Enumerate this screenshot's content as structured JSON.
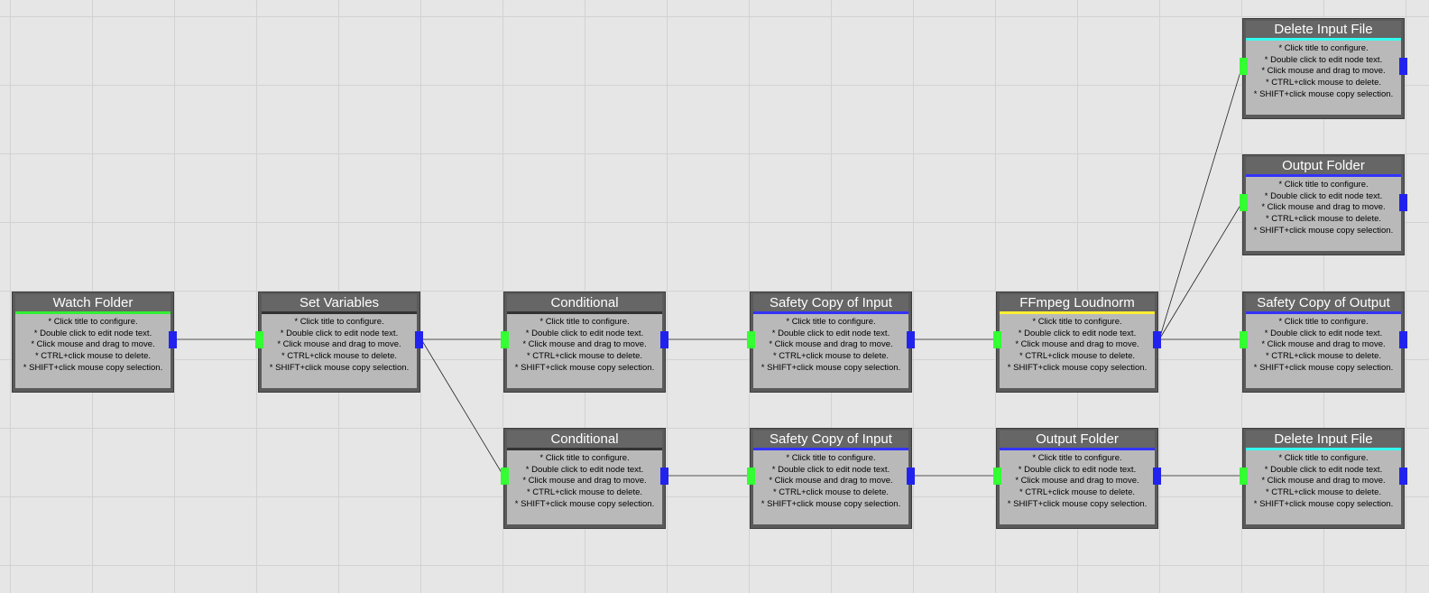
{
  "help_lines": [
    "* Click title to configure.",
    "* Double click to edit node text.",
    "* Click mouse and drag to move.",
    "* CTRL+click mouse to delete.",
    "* SHIFT+click mouse copy selection."
  ],
  "colors": {
    "background": "#e6e6e6",
    "grid": "#d2d2d2",
    "input_port": "#33ff33",
    "output_port": "#2222ee",
    "link": "#222222"
  },
  "nodes": [
    {
      "id": "watch-folder",
      "title": "Watch Folder",
      "bar_color": "#33ee33",
      "ports": [
        "out"
      ]
    },
    {
      "id": "set-variables",
      "title": "Set Variables",
      "bar_color": "#333333",
      "ports": [
        "in",
        "out"
      ]
    },
    {
      "id": "conditional-1",
      "title": "Conditional",
      "bar_color": "#333333",
      "ports": [
        "in",
        "out"
      ]
    },
    {
      "id": "safety-copy-input-1",
      "title": "Safety Copy of Input",
      "bar_color": "#3333ff",
      "ports": [
        "in",
        "out"
      ]
    },
    {
      "id": "ffmpeg-loudnorm",
      "title": "FFmpeg Loudnorm",
      "bar_color": "#ffee33",
      "ports": [
        "in",
        "out"
      ]
    },
    {
      "id": "delete-input-file-1",
      "title": "Delete Input File",
      "bar_color": "#33ffee",
      "ports": [
        "in",
        "out"
      ]
    },
    {
      "id": "output-folder-1",
      "title": "Output Folder",
      "bar_color": "#3333ff",
      "ports": [
        "in",
        "out"
      ]
    },
    {
      "id": "safety-copy-output",
      "title": "Safety Copy of Output",
      "bar_color": "#3333ff",
      "ports": [
        "in",
        "out"
      ]
    },
    {
      "id": "conditional-2",
      "title": "Conditional",
      "bar_color": "#333333",
      "ports": [
        "in",
        "out"
      ]
    },
    {
      "id": "safety-copy-input-2",
      "title": "Safety Copy of Input",
      "bar_color": "#3333ff",
      "ports": [
        "in",
        "out"
      ]
    },
    {
      "id": "output-folder-2",
      "title": "Output Folder",
      "bar_color": "#3333ff",
      "ports": [
        "in",
        "out"
      ]
    },
    {
      "id": "delete-input-file-2",
      "title": "Delete Input File",
      "bar_color": "#33ffee",
      "ports": [
        "in",
        "out"
      ]
    }
  ],
  "links": [
    [
      "watch-folder",
      "set-variables"
    ],
    [
      "set-variables",
      "conditional-1"
    ],
    [
      "set-variables",
      "conditional-2"
    ],
    [
      "conditional-1",
      "safety-copy-input-1"
    ],
    [
      "safety-copy-input-1",
      "ffmpeg-loudnorm"
    ],
    [
      "ffmpeg-loudnorm",
      "delete-input-file-1"
    ],
    [
      "ffmpeg-loudnorm",
      "output-folder-1"
    ],
    [
      "ffmpeg-loudnorm",
      "safety-copy-output"
    ],
    [
      "conditional-2",
      "safety-copy-input-2"
    ],
    [
      "safety-copy-input-2",
      "output-folder-2"
    ],
    [
      "output-folder-2",
      "delete-input-file-2"
    ]
  ]
}
